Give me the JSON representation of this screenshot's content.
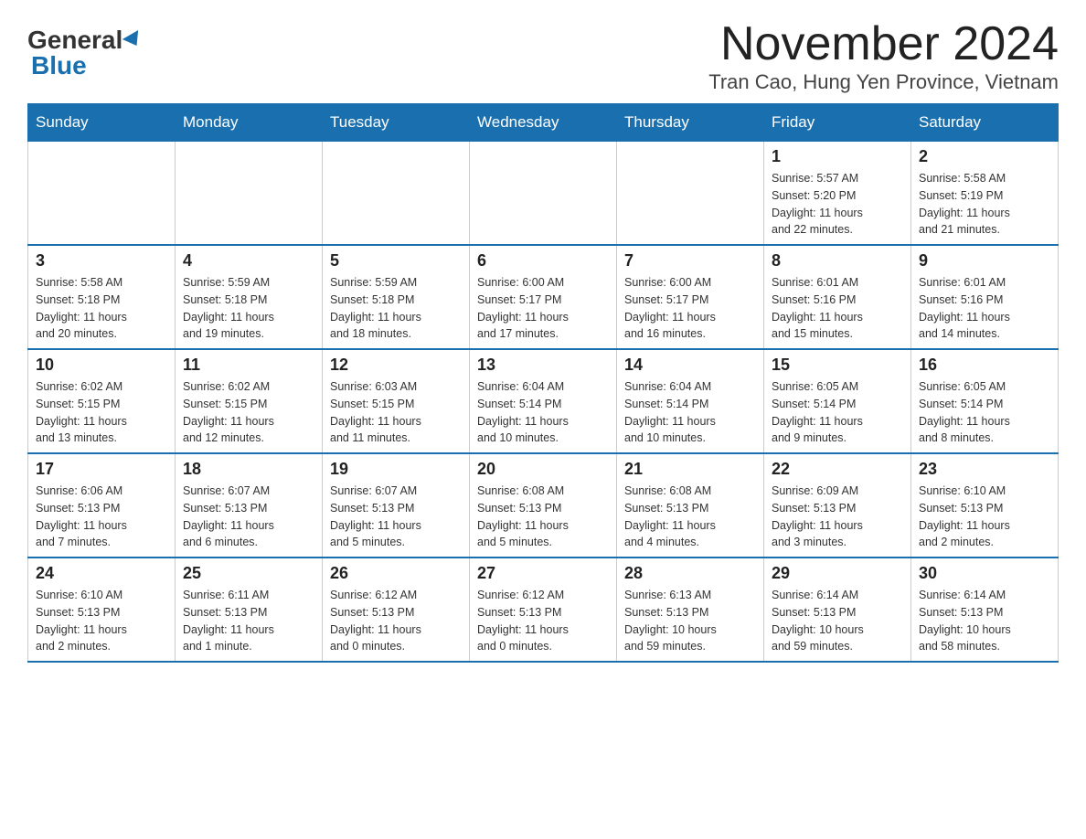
{
  "logo": {
    "general": "General",
    "blue": "Blue"
  },
  "title": "November 2024",
  "subtitle": "Tran Cao, Hung Yen Province, Vietnam",
  "days_of_week": [
    "Sunday",
    "Monday",
    "Tuesday",
    "Wednesday",
    "Thursday",
    "Friday",
    "Saturday"
  ],
  "weeks": [
    [
      {
        "day": "",
        "info": ""
      },
      {
        "day": "",
        "info": ""
      },
      {
        "day": "",
        "info": ""
      },
      {
        "day": "",
        "info": ""
      },
      {
        "day": "",
        "info": ""
      },
      {
        "day": "1",
        "info": "Sunrise: 5:57 AM\nSunset: 5:20 PM\nDaylight: 11 hours\nand 22 minutes."
      },
      {
        "day": "2",
        "info": "Sunrise: 5:58 AM\nSunset: 5:19 PM\nDaylight: 11 hours\nand 21 minutes."
      }
    ],
    [
      {
        "day": "3",
        "info": "Sunrise: 5:58 AM\nSunset: 5:18 PM\nDaylight: 11 hours\nand 20 minutes."
      },
      {
        "day": "4",
        "info": "Sunrise: 5:59 AM\nSunset: 5:18 PM\nDaylight: 11 hours\nand 19 minutes."
      },
      {
        "day": "5",
        "info": "Sunrise: 5:59 AM\nSunset: 5:18 PM\nDaylight: 11 hours\nand 18 minutes."
      },
      {
        "day": "6",
        "info": "Sunrise: 6:00 AM\nSunset: 5:17 PM\nDaylight: 11 hours\nand 17 minutes."
      },
      {
        "day": "7",
        "info": "Sunrise: 6:00 AM\nSunset: 5:17 PM\nDaylight: 11 hours\nand 16 minutes."
      },
      {
        "day": "8",
        "info": "Sunrise: 6:01 AM\nSunset: 5:16 PM\nDaylight: 11 hours\nand 15 minutes."
      },
      {
        "day": "9",
        "info": "Sunrise: 6:01 AM\nSunset: 5:16 PM\nDaylight: 11 hours\nand 14 minutes."
      }
    ],
    [
      {
        "day": "10",
        "info": "Sunrise: 6:02 AM\nSunset: 5:15 PM\nDaylight: 11 hours\nand 13 minutes."
      },
      {
        "day": "11",
        "info": "Sunrise: 6:02 AM\nSunset: 5:15 PM\nDaylight: 11 hours\nand 12 minutes."
      },
      {
        "day": "12",
        "info": "Sunrise: 6:03 AM\nSunset: 5:15 PM\nDaylight: 11 hours\nand 11 minutes."
      },
      {
        "day": "13",
        "info": "Sunrise: 6:04 AM\nSunset: 5:14 PM\nDaylight: 11 hours\nand 10 minutes."
      },
      {
        "day": "14",
        "info": "Sunrise: 6:04 AM\nSunset: 5:14 PM\nDaylight: 11 hours\nand 10 minutes."
      },
      {
        "day": "15",
        "info": "Sunrise: 6:05 AM\nSunset: 5:14 PM\nDaylight: 11 hours\nand 9 minutes."
      },
      {
        "day": "16",
        "info": "Sunrise: 6:05 AM\nSunset: 5:14 PM\nDaylight: 11 hours\nand 8 minutes."
      }
    ],
    [
      {
        "day": "17",
        "info": "Sunrise: 6:06 AM\nSunset: 5:13 PM\nDaylight: 11 hours\nand 7 minutes."
      },
      {
        "day": "18",
        "info": "Sunrise: 6:07 AM\nSunset: 5:13 PM\nDaylight: 11 hours\nand 6 minutes."
      },
      {
        "day": "19",
        "info": "Sunrise: 6:07 AM\nSunset: 5:13 PM\nDaylight: 11 hours\nand 5 minutes."
      },
      {
        "day": "20",
        "info": "Sunrise: 6:08 AM\nSunset: 5:13 PM\nDaylight: 11 hours\nand 5 minutes."
      },
      {
        "day": "21",
        "info": "Sunrise: 6:08 AM\nSunset: 5:13 PM\nDaylight: 11 hours\nand 4 minutes."
      },
      {
        "day": "22",
        "info": "Sunrise: 6:09 AM\nSunset: 5:13 PM\nDaylight: 11 hours\nand 3 minutes."
      },
      {
        "day": "23",
        "info": "Sunrise: 6:10 AM\nSunset: 5:13 PM\nDaylight: 11 hours\nand 2 minutes."
      }
    ],
    [
      {
        "day": "24",
        "info": "Sunrise: 6:10 AM\nSunset: 5:13 PM\nDaylight: 11 hours\nand 2 minutes."
      },
      {
        "day": "25",
        "info": "Sunrise: 6:11 AM\nSunset: 5:13 PM\nDaylight: 11 hours\nand 1 minute."
      },
      {
        "day": "26",
        "info": "Sunrise: 6:12 AM\nSunset: 5:13 PM\nDaylight: 11 hours\nand 0 minutes."
      },
      {
        "day": "27",
        "info": "Sunrise: 6:12 AM\nSunset: 5:13 PM\nDaylight: 11 hours\nand 0 minutes."
      },
      {
        "day": "28",
        "info": "Sunrise: 6:13 AM\nSunset: 5:13 PM\nDaylight: 10 hours\nand 59 minutes."
      },
      {
        "day": "29",
        "info": "Sunrise: 6:14 AM\nSunset: 5:13 PM\nDaylight: 10 hours\nand 59 minutes."
      },
      {
        "day": "30",
        "info": "Sunrise: 6:14 AM\nSunset: 5:13 PM\nDaylight: 10 hours\nand 58 minutes."
      }
    ]
  ]
}
